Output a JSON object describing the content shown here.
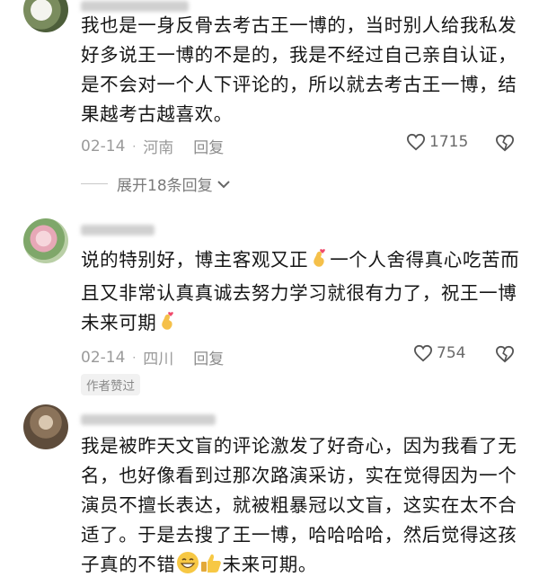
{
  "comments": [
    {
      "username": "",
      "text": "我也是一身反骨去考古王一博的，当时别人给我私发好多说王一博的不是的，我是不经过自己亲自认证，是不会对一个人下评论的，所以就去考古王一博，结果越考古越喜欢。",
      "date": "02-14",
      "location": "河南",
      "reply_label": "回复",
      "likes": "1715",
      "expand_label": "展开18条回复"
    },
    {
      "username": "",
      "text_part1": "说的特别好，博主客观又正",
      "text_part2": "一个人舍得真心吃苦而且又非常认真真诚去努力学习就很有力了，祝王一博未来可期",
      "date": "02-14",
      "location": "四川",
      "reply_label": "回复",
      "likes": "754",
      "badge": "作者赞过"
    },
    {
      "username": "",
      "text_part1": "我是被昨天文盲的评论激发了好奇心，因为我看了无名，也好像看到过那次路演采访，实在觉得因为一个演员不擅长表达，就被粗暴冠以文盲，这实在太不合适了。于是去搜了王一博，哈哈哈哈，然后觉得这孩子真的不错",
      "text_part2": "未来可期。"
    }
  ],
  "icons": {
    "heart": "heart-outline-icon",
    "dislike": "broken-heart-icon",
    "expand": "chevron-down-icon",
    "finger_heart": "finger-heart-emoji",
    "grin": "grinning-face-emoji",
    "thumbs": "thumbs-up-emoji"
  },
  "colors": {
    "text": "#161616",
    "meta": "#9a9a9a",
    "badge_bg": "#f1f1f1"
  }
}
